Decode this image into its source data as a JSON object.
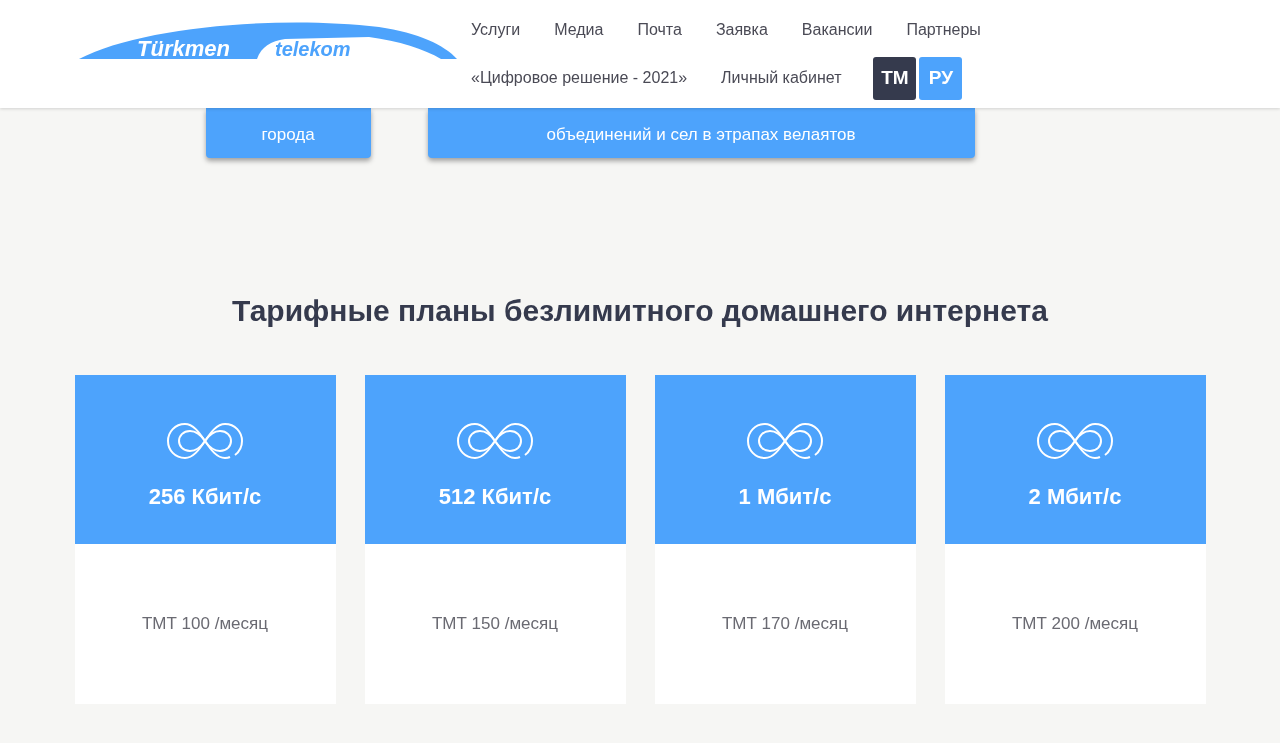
{
  "logo": {
    "word_1": "Türkmen",
    "word_2": "telekom"
  },
  "nav": [
    {
      "label": "Услуги"
    },
    {
      "label": "Медиа"
    },
    {
      "label": "Почта"
    },
    {
      "label": "Заявка"
    },
    {
      "label": "Вакансии"
    },
    {
      "label": "Партнеры"
    },
    {
      "label": "«Цифровое решение - 2021»"
    },
    {
      "label": "Личный кабинет"
    }
  ],
  "languages": [
    {
      "label": "ТМ",
      "selected": false
    },
    {
      "label": "РУ",
      "selected": true
    }
  ],
  "tariff_buttons": [
    {
      "label": "города"
    },
    {
      "label": "объединений и сел в этрапах велаятов"
    }
  ],
  "heading": "Тарифные планы безлимитного домашнего интернета",
  "plans": [
    {
      "speed": "256 Кбит/с",
      "price": "ТМТ 100 /месяц"
    },
    {
      "speed": "512 Кбит/с",
      "price": "ТМТ 150 /месяц"
    },
    {
      "speed": "1 Мбит/с",
      "price": "ТМТ 170 /месяц"
    },
    {
      "speed": "2 Мбит/с",
      "price": "ТМТ 200 /месяц"
    }
  ]
}
